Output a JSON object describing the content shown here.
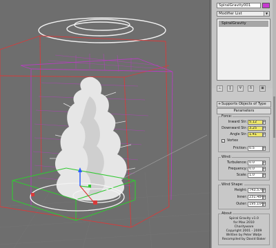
{
  "panel": {
    "object_name": "SpiralGravity001",
    "modifier_list_label": "Modifier List",
    "stack_items": [
      "SpiralGravity"
    ],
    "rollouts": {
      "supports": "Supports Objects of Type",
      "parameters": "Parameters",
      "about": "About"
    },
    "force": {
      "title": "Force:",
      "inward_label": "Inward Str:",
      "inward_value": "5.12",
      "downward_label": "Downward Str:",
      "downward_value": "3.25",
      "angle_label": "Angle Str:",
      "angle_value": "1.41",
      "vortex_label": "Vortex",
      "vortex_checked": true,
      "friction_label": "Friction:",
      "friction_value": "0.5"
    },
    "wind": {
      "title": "Wind:",
      "turbulence_label": "Turbulence:",
      "turbulence_value": "0.0",
      "frequency_label": "Frequency:",
      "frequency_value": "0.0",
      "scale_label": "Scale:",
      "scale_value": "1.0"
    },
    "wind_shape": {
      "title": "Wind Shape:",
      "height_label": "Height:",
      "height_value": "743.576",
      "inner_label": "Inner:",
      "inner_value": "231.484",
      "outer_label": "Outer:",
      "outer_value": "195.104"
    },
    "about": {
      "line1": "Spiral Gravity v1.0",
      "line2": "for Max 2010",
      "line3": "Charityware",
      "line4": "Copyright 2001 - 2009",
      "line5": "Written by Peter Watje",
      "line6": "Recompiled by David Baker"
    }
  },
  "colors": {
    "viewport_bg": "#6e6e6e",
    "gizmo_magenta": "#b73fc0",
    "box_red": "#d93a3a",
    "box_green": "#32c832",
    "particles": "#e8e8e8",
    "highlight_field": "#efe86a",
    "object_color_swatch": "#c63ad1"
  },
  "icons": {
    "pin_stack": "pin-icon",
    "show_end_result": "show-end-result-icon",
    "make_unique": "make-unique-icon",
    "remove_modifier": "remove-modifier-icon",
    "configure_sets": "configure-modifier-sets-icon"
  }
}
